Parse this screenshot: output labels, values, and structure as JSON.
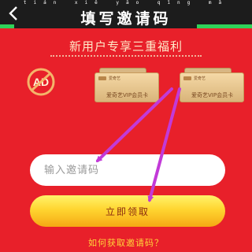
{
  "header": {
    "title": "填写邀请码",
    "pinyin": "tián xiě yāo qǐng mǎ",
    "back_icon": "chevron-left-icon"
  },
  "banner": {
    "title": "新用户专享三重福利"
  },
  "benefits": {
    "ad_icon": "no-ads-icon",
    "ad_text": "AD",
    "cards": [
      {
        "brand": "爱奇艺",
        "label": "爱奇艺VIP会员卡"
      },
      {
        "brand": "爱奇艺",
        "label": "爱奇艺VIP会员卡"
      }
    ]
  },
  "form": {
    "input_placeholder": "输入邀请码",
    "submit_label": "立即领取"
  },
  "footer": {
    "help_link": "如何获取邀请码？"
  },
  "colors": {
    "background": "#e8202a",
    "topbar": "#1c1c1c",
    "accent_green": "#2fd25a",
    "button_yellow": "#ffd530",
    "annotation_arrow": "#c23ad8"
  }
}
